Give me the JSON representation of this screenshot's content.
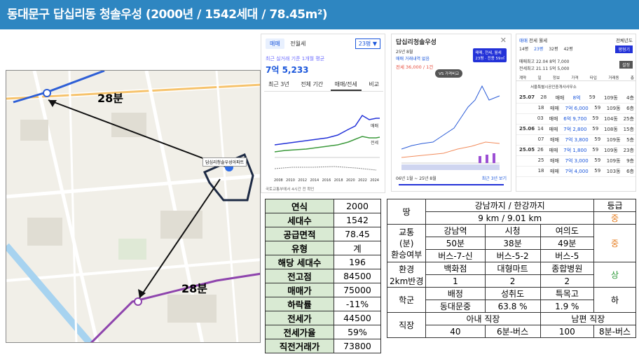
{
  "title": "동대문구 답십리동 청솔우성 (2000년 / 1542세대 / 78.45m²)",
  "map": {
    "label_top": "28분",
    "label_bottom": "28분",
    "popup_text": "답십리청솔우성아파트"
  },
  "price_panel": {
    "tab_sale": "매매",
    "tab_jeonse": "전월세",
    "size_select": "23평 ▼",
    "caption": "최근 실거래 기준 1개월 평균",
    "price": "7억 5,233",
    "tabs": [
      "최근 3년",
      "전체 기간",
      "매매/전세",
      "비교"
    ],
    "x_labels": [
      "2008",
      "2010",
      "2012",
      "2014",
      "2016",
      "2018",
      "2020",
      "2022",
      "2024"
    ],
    "legend_sale": "매매",
    "legend_jeonse": "전세",
    "footnote": "국토교통부에서 4시간 전 확인"
  },
  "chart_panel": {
    "title": "답십리청솔우성",
    "date": "25년 8월",
    "no_deal": "매매 거래내역 없음",
    "jeonse": "전세 36,000 / 1건",
    "vs_button": "VS 가격비교",
    "badge_line1": "매매, 전세, 월세",
    "badge_line2": "23평 · 전용 59㎡",
    "range": "06년 1월 ~ 25년 8월",
    "range_link": "최근 3년 보기"
  },
  "deal_panel": {
    "tab_sale": "매매",
    "tab_jeonse": "전세",
    "tab_monthly": "월세",
    "year_filter": "전체년도",
    "sizes": [
      "14평",
      "23평",
      "32평",
      "42평"
    ],
    "button_apply": "평형기",
    "line1": "매매최고 22.04 8억 7,000",
    "line2": "전세최고 21.11 5억 5,000",
    "button_set": "설정",
    "headers": [
      "계약",
      "일",
      "정보",
      "가격",
      "타입",
      "거래동",
      "층"
    ],
    "realtor": "서울특별시공인중개사사무소",
    "rows": [
      {
        "ym": "25.07",
        "d": "28",
        "info": "매매",
        "price": "8억",
        "type": "59",
        "dong": "109동",
        "floor": "4층"
      },
      {
        "ym": "",
        "d": "18",
        "info": "매매",
        "price": "7억 6,000",
        "type": "59",
        "dong": "109동",
        "floor": "6층"
      },
      {
        "ym": "",
        "d": "03",
        "info": "매매",
        "price": "6억 9,700",
        "type": "59",
        "dong": "104동",
        "floor": "25층"
      },
      {
        "ym": "25.06",
        "d": "14",
        "info": "매매",
        "price": "7억 2,800",
        "type": "59",
        "dong": "108동",
        "floor": "15층"
      },
      {
        "ym": "",
        "d": "07",
        "info": "매매",
        "price": "7억 3,800",
        "type": "59",
        "dong": "109동",
        "floor": "5층"
      },
      {
        "ym": "25.05",
        "d": "26",
        "info": "매매",
        "price": "7억 1,800",
        "type": "59",
        "dong": "109동",
        "floor": "23층"
      },
      {
        "ym": "",
        "d": "25",
        "info": "매매",
        "price": "7억 3,000",
        "type": "59",
        "dong": "109동",
        "floor": "9층"
      },
      {
        "ym": "",
        "d": "18",
        "info": "매매",
        "price": "7억 4,000",
        "type": "59",
        "dong": "103동",
        "floor": "6층"
      }
    ]
  },
  "stats": [
    {
      "label": "연식",
      "value": "2000"
    },
    {
      "label": "세대수",
      "value": "1542"
    },
    {
      "label": "공급면적",
      "value": "78.45"
    },
    {
      "label": "유형",
      "value": "계"
    },
    {
      "label": "해당 세대수",
      "value": "196"
    },
    {
      "label": "전고점",
      "value": "84500"
    },
    {
      "label": "매매가",
      "value": "75000"
    },
    {
      "label": "하락률",
      "value": "-11%"
    },
    {
      "label": "전세가",
      "value": "44500"
    },
    {
      "label": "전세가율",
      "value": "59%"
    },
    {
      "label": "직전거래가",
      "value": "73800"
    }
  ],
  "eval": {
    "land": "땅",
    "land_desc": "강남까지 / 한강까지",
    "grade_header": "등급",
    "land_dist": "9 km / 9.01 km",
    "land_grade": "중",
    "transport_label": "교통(분)환승여부",
    "transport_label_1": "교통",
    "transport_label_2": "(분)",
    "transport_label_3": "환승여부",
    "dest": [
      "강남역",
      "시청",
      "여의도"
    ],
    "minutes": [
      "50분",
      "38분",
      "49분"
    ],
    "transfer": [
      "버스-7-신",
      "버스-5-2",
      "버스-5"
    ],
    "transport_grade": "중",
    "env_label_1": "환경",
    "env_label_2": "2km반경",
    "env_items": [
      "백화점",
      "대형마트",
      "종합병원"
    ],
    "env_counts": [
      "1",
      "2",
      "2"
    ],
    "env_grade": "상",
    "school_label": "학군",
    "school_items": [
      "배정",
      "성취도",
      "특목고"
    ],
    "school_values": [
      "동대문중",
      "63.8 %",
      "1.9 %"
    ],
    "school_grade": "하",
    "work_label": "직장",
    "wife_header": "아내 직장",
    "husband_header": "남편 직장",
    "wife_values": [
      "40",
      "6분-버스"
    ],
    "husband_values": [
      "100",
      "8분-버스"
    ]
  }
}
